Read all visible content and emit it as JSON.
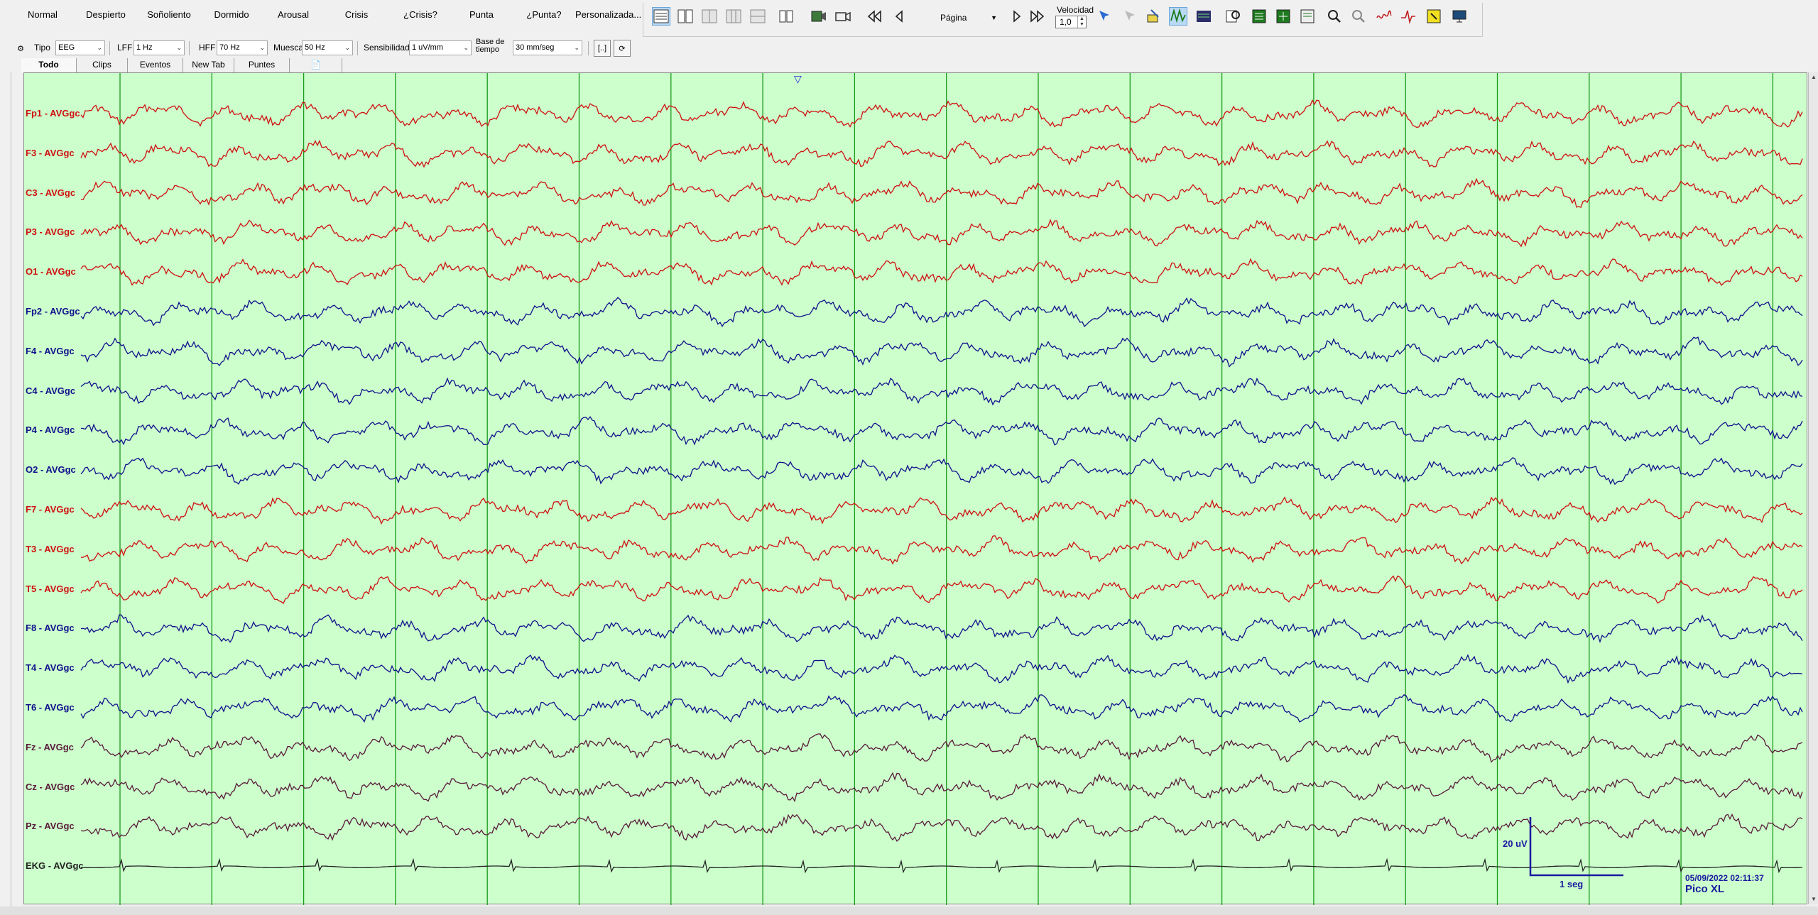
{
  "state_buttons": [
    "Normal",
    "Despierto",
    "Soñoliento",
    "Dormido",
    "Arousal",
    "Crisis",
    "¿Crisis?",
    "Punta",
    "¿Punta?",
    "Personalizada..."
  ],
  "toolbar": {
    "page_mode": "Página",
    "speed_label": "Velocidad",
    "speed_value": "1,0"
  },
  "filters": {
    "tipo_label": "Tipo",
    "tipo_value": "EEG",
    "lff_label": "LFF",
    "lff_value": "1 Hz",
    "hff_label": "HFF",
    "hff_value": "70 Hz",
    "muesca_label": "Muesca",
    "muesca_value": "50 Hz",
    "sensibilidad_label": "Sensibilidad",
    "sensibilidad_value": "1 uV/mm",
    "base_label_1": "Base de",
    "base_label_2": "tiempo",
    "base_value": "30 mm/seg"
  },
  "tabs": [
    "Todo",
    "Clips",
    "Eventos",
    "New Tab",
    "Puntes"
  ],
  "active_tab": "Todo",
  "channels": [
    {
      "label": "Fp1 - AVGgc",
      "color": "#d01010"
    },
    {
      "label": "F3 - AVGgc",
      "color": "#d01010"
    },
    {
      "label": "C3 - AVGgc",
      "color": "#d01010"
    },
    {
      "label": "P3 - AVGgc",
      "color": "#d01010"
    },
    {
      "label": "O1 - AVGgc",
      "color": "#d01010"
    },
    {
      "label": "Fp2 - AVGgc",
      "color": "#10108c"
    },
    {
      "label": "F4 - AVGgc",
      "color": "#10108c"
    },
    {
      "label": "C4 - AVGgc",
      "color": "#10108c"
    },
    {
      "label": "P4 - AVGgc",
      "color": "#10108c"
    },
    {
      "label": "O2 - AVGgc",
      "color": "#10108c"
    },
    {
      "label": "F7 - AVGgc",
      "color": "#d01010"
    },
    {
      "label": "T3 - AVGgc",
      "color": "#d01010"
    },
    {
      "label": "T5 - AVGgc",
      "color": "#d01010"
    },
    {
      "label": "F8 - AVGgc",
      "color": "#10108c"
    },
    {
      "label": "T4 - AVGgc",
      "color": "#10108c"
    },
    {
      "label": "T6 - AVGgc",
      "color": "#10108c"
    },
    {
      "label": "Fz - AVGgc",
      "color": "#5a1a3a"
    },
    {
      "label": "Cz - AVGgc",
      "color": "#5a1a3a"
    },
    {
      "label": "Pz - AVGgc",
      "color": "#5a1a3a"
    },
    {
      "label": "EKG - AVGgc",
      "color": "#222222"
    }
  ],
  "calibration": {
    "amplitude": "20 uV",
    "time": "1 seg"
  },
  "timestamp": "05/09/2022 02:11:37",
  "montage_name": "Pico XL",
  "colors": {
    "background": "#ccffcc",
    "gridline": "#1a9a1a",
    "left_hemisphere": "#d01010",
    "right_hemisphere": "#10108c",
    "midline": "#5a1a3a",
    "calibration": "#1a1aa0"
  }
}
